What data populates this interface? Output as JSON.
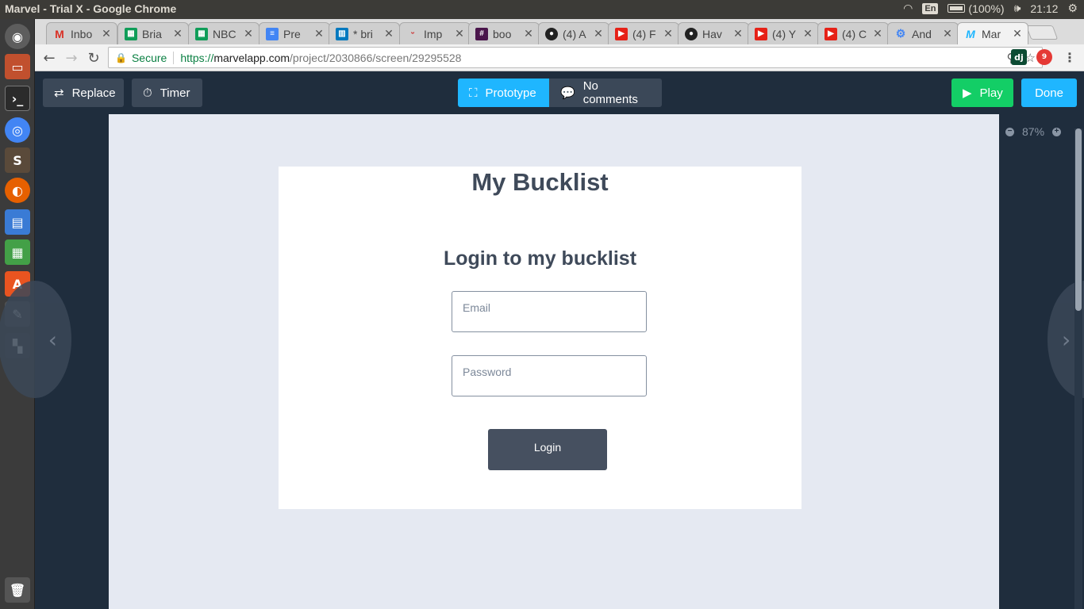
{
  "os": {
    "window_title": "Marvel - Trial X - Google Chrome",
    "keyboard_layout": "En",
    "battery": "(100%)",
    "clock": "21:12"
  },
  "browser": {
    "tabs": [
      {
        "label": "Inbo",
        "icon": "gmail-icon",
        "color": "#d93025"
      },
      {
        "label": "Bria",
        "icon": "sheets-icon",
        "color": "#0f9d58"
      },
      {
        "label": "NBC",
        "icon": "sheets-icon",
        "color": "#0f9d58"
      },
      {
        "label": "Pre",
        "icon": "docs-icon",
        "color": "#4285f4"
      },
      {
        "label": "* bri",
        "icon": "trello-icon",
        "color": "#0079bf"
      },
      {
        "label": "Imp",
        "icon": "app-icon",
        "color": "#e0e0e0"
      },
      {
        "label": "boo",
        "icon": "slack-icon",
        "color": "#4a154b"
      },
      {
        "label": "(4) A",
        "icon": "github-icon",
        "color": "#222222"
      },
      {
        "label": "(4) F",
        "icon": "youtube-icon",
        "color": "#e62117"
      },
      {
        "label": "Hav",
        "icon": "github-icon",
        "color": "#222222"
      },
      {
        "label": "(4) Y",
        "icon": "youtube-icon",
        "color": "#e62117"
      },
      {
        "label": "(4) C",
        "icon": "youtube-icon",
        "color": "#e62117"
      },
      {
        "label": "And",
        "icon": "settings-icon",
        "color": "#4285f4"
      },
      {
        "label": "Mar",
        "icon": "marvel-icon",
        "color": "#1fb6ff"
      }
    ],
    "secure_label": "Secure",
    "url_scheme": "https://",
    "url_host": "marvelapp.com",
    "url_path": "/project/2030866/screen/29295528",
    "ext_badge": "9"
  },
  "marvel": {
    "replace_label": "Replace",
    "timer_label": "Timer",
    "prototype_label": "Prototype",
    "comments_label": "No comments",
    "play_label": "Play",
    "done_label": "Done",
    "zoom_level": "87%",
    "colors": {
      "prototype": "#1fb6ff",
      "play": "#13ce66",
      "done": "#1fb6ff"
    }
  },
  "screen": {
    "app_title": "My Bucklist",
    "login_heading": "Login to my bucklist",
    "email_placeholder": "Email",
    "password_placeholder": "Password",
    "login_button": "Login"
  }
}
